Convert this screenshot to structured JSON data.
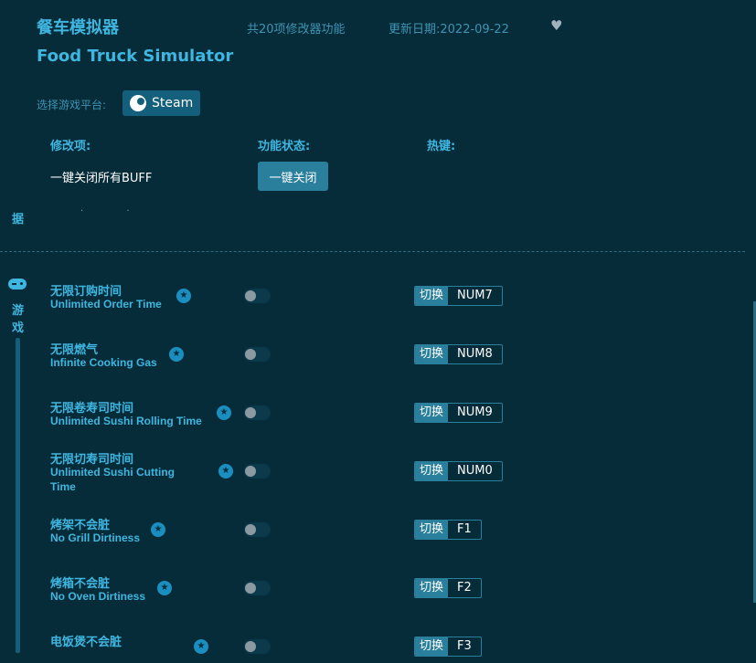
{
  "header": {
    "title_cn": "餐车模拟器",
    "feature_count": "共20项修改器功能",
    "update_date": "更新日期:2022-09-22",
    "title_en": "Food Truck Simulator"
  },
  "platform": {
    "label": "选择游戏平台:",
    "steam_label": "Steam"
  },
  "columns": {
    "mod": "修改项:",
    "status": "功能状态:",
    "hotkey": "热键:"
  },
  "global": {
    "close_all_label": "一键关闭所有BUFF",
    "close_all_button": "一键关闭"
  },
  "sidebar": {
    "top_label": "据",
    "game_label": "游戏"
  },
  "hotkey_prefix": "切换",
  "items": [
    {
      "cn": "无限订购时间",
      "en": "Unlimited Order Time",
      "key": "NUM7"
    },
    {
      "cn": "无限燃气",
      "en": "Infinite Cooking Gas",
      "key": "NUM8"
    },
    {
      "cn": "无限卷寿司时间",
      "en": "Unlimited Sushi Rolling Time",
      "key": "NUM9"
    },
    {
      "cn": "无限切寿司时间",
      "en": "Unlimited Sushi Cutting Time",
      "key": "NUM0"
    },
    {
      "cn": "烤架不会脏",
      "en": "No Grill Dirtiness",
      "key": "F1"
    },
    {
      "cn": "烤箱不会脏",
      "en": "No Oven Dirtiness",
      "key": "F2"
    },
    {
      "cn": "电饭煲不会脏",
      "en": "",
      "key": "F3"
    }
  ]
}
